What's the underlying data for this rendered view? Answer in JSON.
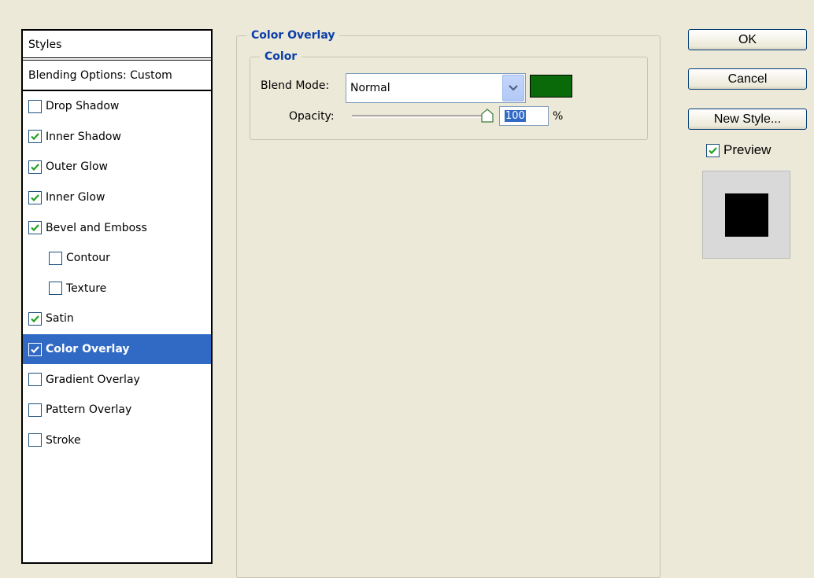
{
  "styles_panel": {
    "header": "Styles",
    "blending_options": "Blending Options: Custom",
    "items": [
      {
        "label": "Drop Shadow",
        "checked": false,
        "indent": false,
        "selected": false
      },
      {
        "label": "Inner Shadow",
        "checked": true,
        "indent": false,
        "selected": false
      },
      {
        "label": "Outer Glow",
        "checked": true,
        "indent": false,
        "selected": false
      },
      {
        "label": "Inner Glow",
        "checked": true,
        "indent": false,
        "selected": false
      },
      {
        "label": "Bevel and Emboss",
        "checked": true,
        "indent": false,
        "selected": false
      },
      {
        "label": "Contour",
        "checked": false,
        "indent": true,
        "selected": false
      },
      {
        "label": "Texture",
        "checked": false,
        "indent": true,
        "selected": false
      },
      {
        "label": "Satin",
        "checked": true,
        "indent": false,
        "selected": false
      },
      {
        "label": "Color Overlay",
        "checked": true,
        "indent": false,
        "selected": true
      },
      {
        "label": "Gradient Overlay",
        "checked": false,
        "indent": false,
        "selected": false
      },
      {
        "label": "Pattern Overlay",
        "checked": false,
        "indent": false,
        "selected": false
      },
      {
        "label": "Stroke",
        "checked": false,
        "indent": false,
        "selected": false
      }
    ]
  },
  "overlay": {
    "group_title": "Color Overlay",
    "color_group_title": "Color",
    "blend_mode_label": "Blend Mode:",
    "blend_mode_value": "Normal",
    "swatch_color": "#0a6a0a",
    "opacity_label": "Opacity:",
    "opacity_value": "100",
    "opacity_unit": "%"
  },
  "buttons": {
    "ok": "OK",
    "cancel": "Cancel",
    "new_style": "New Style...",
    "preview_label": "Preview",
    "preview_checked": true
  },
  "colors": {
    "selection": "#316ac5",
    "group_title": "#0a3ea8",
    "check": "#21a121"
  }
}
